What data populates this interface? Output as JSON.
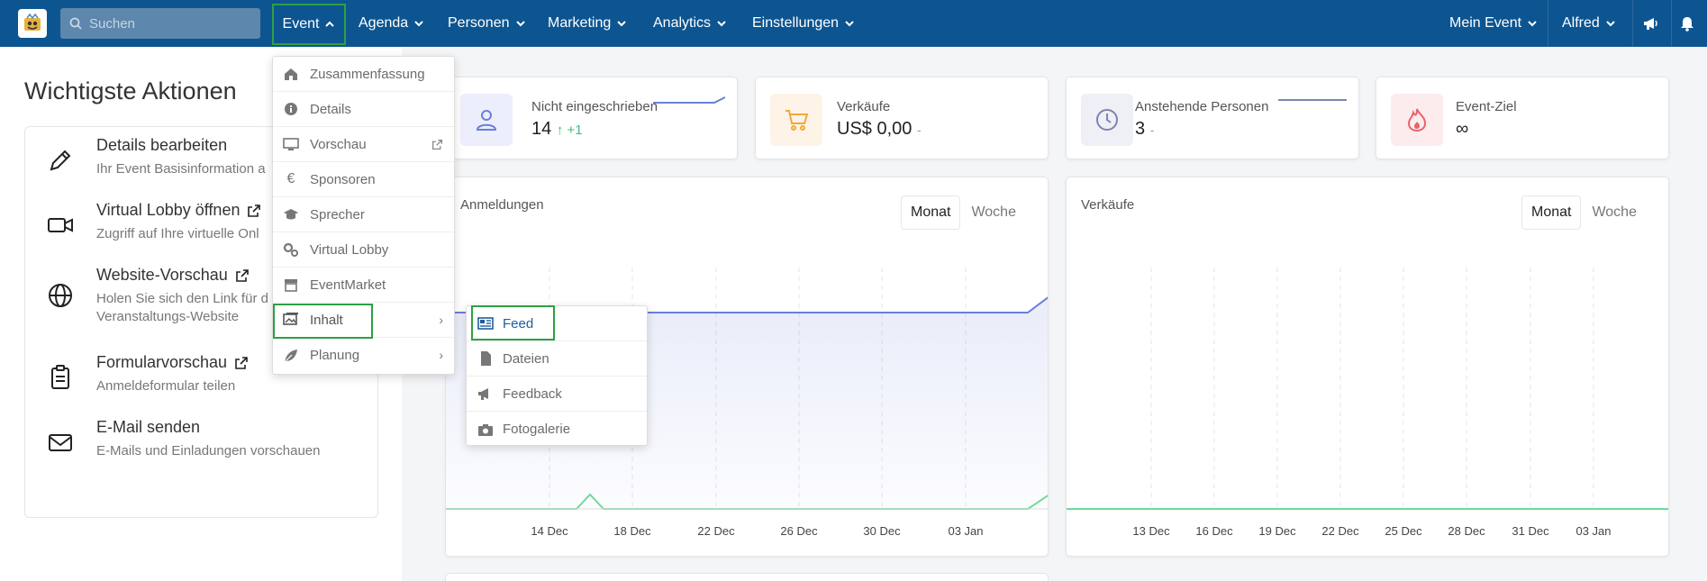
{
  "nav": {
    "search_placeholder": "Suchen",
    "items": [
      "Event",
      "Agenda",
      "Personen",
      "Marketing",
      "Analytics",
      "Einstellungen"
    ],
    "right": [
      "Mein Event",
      "Alfred"
    ]
  },
  "left": {
    "title": "Wichtigste Aktionen",
    "actions": [
      {
        "title": "Details bearbeiten",
        "sub": "Ihr Event Basisinformation a"
      },
      {
        "title": "Virtual Lobby öffnen",
        "sub": "Zugriff auf Ihre virtuelle Onl"
      },
      {
        "title": "Website-Vorschau",
        "sub": "Holen Sie sich den Link für d",
        "sub2": "Veranstaltungs-Website"
      },
      {
        "title": "Formularvorschau",
        "sub": "Anmeldeformular teilen"
      },
      {
        "title": "E-Mail senden",
        "sub": "E-Mails und Einladungen vorschauen"
      }
    ]
  },
  "cards": [
    {
      "label": "Nicht eingeschrieben",
      "value": "14",
      "delta": "↑ +1"
    },
    {
      "label": "Verkäufe",
      "value": "US$ 0,00",
      "delta": "-"
    },
    {
      "label": "Anstehende Personen",
      "value": "3",
      "delta": "-"
    },
    {
      "label": "Event-Ziel",
      "value": "∞"
    }
  ],
  "charts": {
    "registrations": {
      "title": "Anmeldungen",
      "toggle": [
        "Monat",
        "Woche"
      ],
      "xlabels": [
        "14 Dec",
        "18 Dec",
        "22 Dec",
        "26 Dec",
        "30 Dec",
        "03 Jan"
      ]
    },
    "sales": {
      "title": "Verkäufe",
      "toggle": [
        "Monat",
        "Woche"
      ],
      "xlabels": [
        "13 Dec",
        "16 Dec",
        "19 Dec",
        "22 Dec",
        "25 Dec",
        "28 Dec",
        "31 Dec",
        "03 Jan"
      ]
    }
  },
  "dropdown": {
    "items": [
      "Zusammenfassung",
      "Details",
      "Vorschau",
      "Sponsoren",
      "Sprecher",
      "Virtual Lobby",
      "EventMarket",
      "Inhalt",
      "Planung"
    ]
  },
  "submenu": {
    "items": [
      "Feed",
      "Dateien",
      "Feedback",
      "Fotogalerie"
    ]
  },
  "colors": {
    "nav_bg": "#0d5591",
    "highlight": "#2ea043",
    "line_blue": "#6a7fdb",
    "line_green": "#6fd99a"
  }
}
